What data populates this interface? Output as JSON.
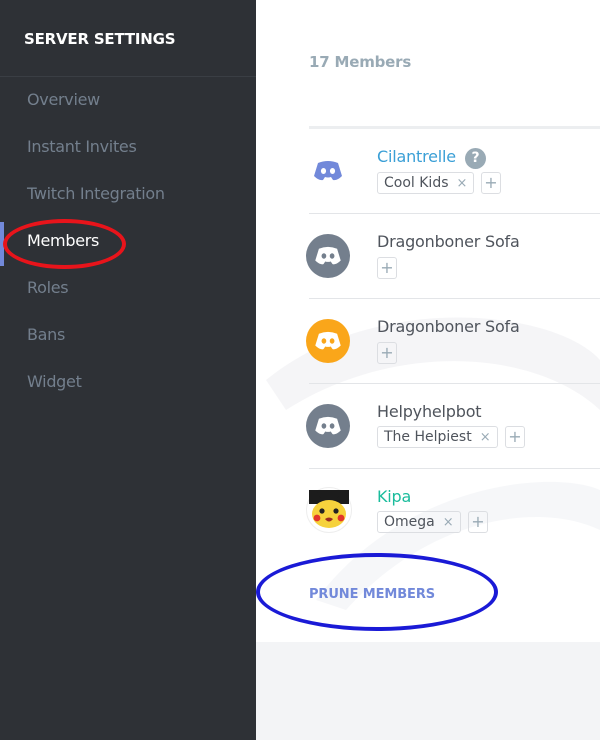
{
  "sidebar": {
    "title": "SERVER SETTINGS",
    "items": [
      {
        "label": "Overview"
      },
      {
        "label": "Instant Invites"
      },
      {
        "label": "Twitch Integration"
      },
      {
        "label": "Members"
      },
      {
        "label": "Roles"
      },
      {
        "label": "Bans"
      },
      {
        "label": "Widget"
      }
    ],
    "active_item": "Members"
  },
  "main": {
    "members_count": "17 Members",
    "members": [
      {
        "name": "Cilantrelle",
        "name_color": "#3a9fd6",
        "avatar_icon": "discord-logo-icon",
        "help_badge": "?",
        "roles": [
          {
            "label": "Cool Kids",
            "remove": "×"
          }
        ],
        "add_role": "+"
      },
      {
        "name": "Dragonboner Sofa",
        "name_color": "#4f545c",
        "avatar_icon": "discord-logo-icon",
        "roles": [],
        "add_role": "+"
      },
      {
        "name": "Dragonboner Sofa",
        "name_color": "#4f545c",
        "avatar_icon": "discord-logo-icon",
        "roles": [],
        "add_role": "+"
      },
      {
        "name": "Helpyhelpbot",
        "name_color": "#4f545c",
        "avatar_icon": "discord-logo-icon",
        "roles": [
          {
            "label": "The Helpiest",
            "remove": "×"
          }
        ],
        "add_role": "+"
      },
      {
        "name": "Kipa",
        "name_color": "#1abc9c",
        "avatar_icon": "pikachu-avatar-icon",
        "roles": [
          {
            "label": "Omega",
            "remove": "×"
          }
        ],
        "add_role": "+"
      }
    ],
    "prune_label": "PRUNE MEMBERS"
  },
  "colors": {
    "sidebar_bg": "#2e3136",
    "accent": "#7289da",
    "annotation_red": "#e8141b",
    "annotation_blue": "#1a1ad6"
  }
}
